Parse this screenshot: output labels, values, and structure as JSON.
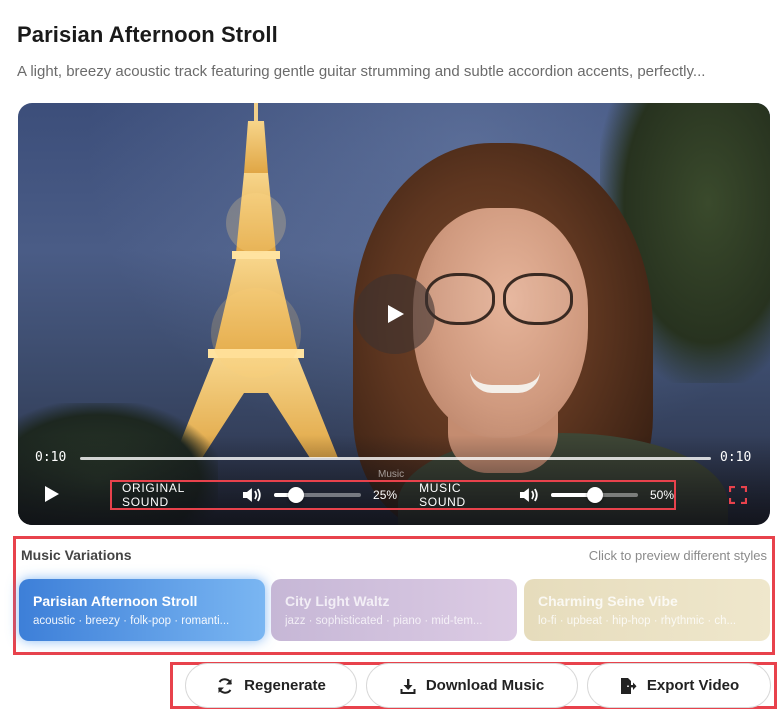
{
  "header": {
    "title": "Parisian Afternoon Stroll",
    "description": "A light, breezy acoustic track featuring gentle guitar strumming and subtle accordion accents, perfectly..."
  },
  "player": {
    "time_current": "0:10",
    "time_total": "0:10",
    "progress": 1.0,
    "music_tooltip": "Music",
    "original_sound": {
      "label": "ORIGINAL SOUND",
      "value_label": "25%",
      "value": 25
    },
    "music_sound": {
      "label": "MUSIC SOUND",
      "value_label": "50%",
      "value": 50
    }
  },
  "variations": {
    "heading": "Music Variations",
    "hint": "Click to preview different styles",
    "items": [
      {
        "title": "Parisian Afternoon Stroll",
        "tags": "acoustic · breezy · folk-pop · romanti..."
      },
      {
        "title": "City Light Waltz",
        "tags": "jazz · sophisticated · piano · mid-tem..."
      },
      {
        "title": "Charming Seine Vibe",
        "tags": "lo-fi · upbeat · hip-hop · rhythmic · ch..."
      }
    ]
  },
  "actions": {
    "regenerate": "Regenerate",
    "download": "Download Music",
    "export": "Export Video"
  }
}
